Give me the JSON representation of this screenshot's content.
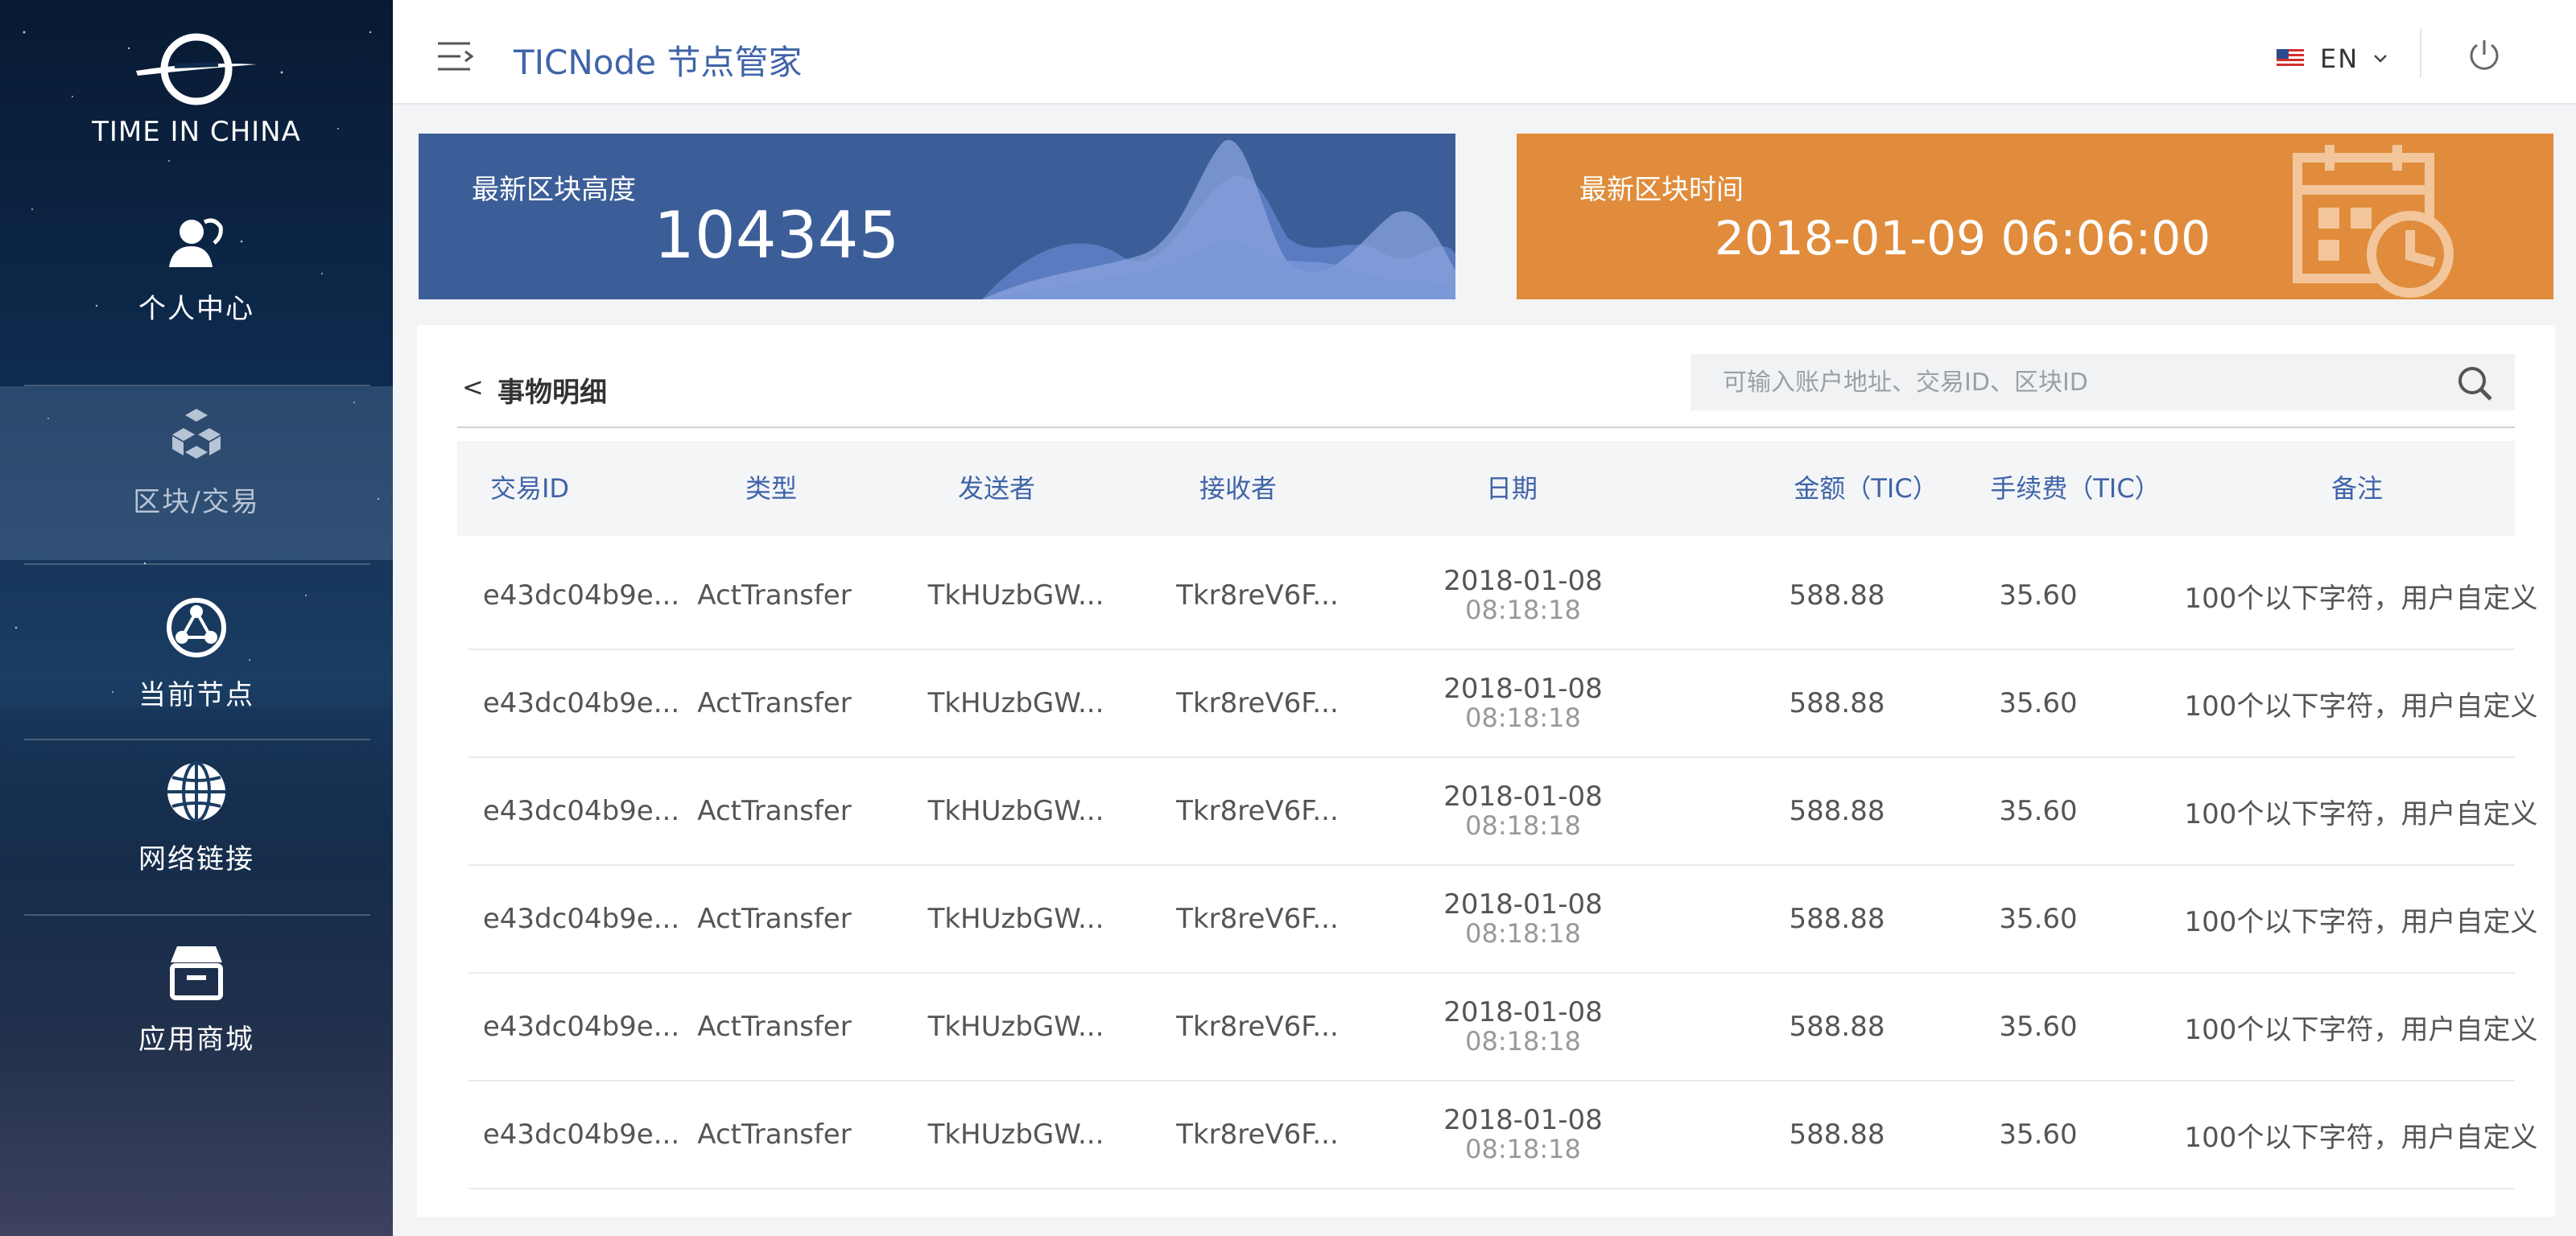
{
  "brand": {
    "logo_text": "TIME IN CHINA"
  },
  "sidebar": {
    "items": [
      {
        "label": "个人中心",
        "icon": "user-icon",
        "active": false
      },
      {
        "label": "区块/交易",
        "icon": "cubes-icon",
        "active": true
      },
      {
        "label": "当前节点",
        "icon": "node-icon",
        "active": false
      },
      {
        "label": "网络链接",
        "icon": "globe-icon",
        "active": false
      },
      {
        "label": "应用商城",
        "icon": "store-icon",
        "active": false
      }
    ]
  },
  "header": {
    "title": "TICNode 节点管家",
    "language": "EN"
  },
  "cards": {
    "block_height": {
      "label": "最新区块高度",
      "value": "104345"
    },
    "block_time": {
      "label": "最新区块时间",
      "value": "2018-01-09 06:06:00"
    }
  },
  "panel": {
    "back_label": "<",
    "title": "事物明细",
    "search_placeholder": "可输入账户地址、交易ID、区块ID"
  },
  "table": {
    "columns": [
      "交易ID",
      "类型",
      "发送者",
      "接收者",
      "日期",
      "金额（TIC）",
      "手续费（TIC）",
      "备注"
    ],
    "rows": [
      {
        "id": "e43dc04b9e...",
        "type": "ActTransfer",
        "sender": "TkHUzbGW...",
        "receiver": "Tkr8reV6F...",
        "date": "2018-01-08",
        "time": "08:18:18",
        "amount": "588.88",
        "fee": "35.60",
        "note": "100个以下字符，用户自定义"
      },
      {
        "id": "e43dc04b9e...",
        "type": "ActTransfer",
        "sender": "TkHUzbGW...",
        "receiver": "Tkr8reV6F...",
        "date": "2018-01-08",
        "time": "08:18:18",
        "amount": "588.88",
        "fee": "35.60",
        "note": "100个以下字符，用户自定义"
      },
      {
        "id": "e43dc04b9e...",
        "type": "ActTransfer",
        "sender": "TkHUzbGW...",
        "receiver": "Tkr8reV6F...",
        "date": "2018-01-08",
        "time": "08:18:18",
        "amount": "588.88",
        "fee": "35.60",
        "note": "100个以下字符，用户自定义"
      },
      {
        "id": "e43dc04b9e...",
        "type": "ActTransfer",
        "sender": "TkHUzbGW...",
        "receiver": "Tkr8reV6F...",
        "date": "2018-01-08",
        "time": "08:18:18",
        "amount": "588.88",
        "fee": "35.60",
        "note": "100个以下字符，用户自定义"
      },
      {
        "id": "e43dc04b9e...",
        "type": "ActTransfer",
        "sender": "TkHUzbGW...",
        "receiver": "Tkr8reV6F...",
        "date": "2018-01-08",
        "time": "08:18:18",
        "amount": "588.88",
        "fee": "35.60",
        "note": "100个以下字符，用户自定义"
      },
      {
        "id": "e43dc04b9e...",
        "type": "ActTransfer",
        "sender": "TkHUzbGW...",
        "receiver": "Tkr8reV6F...",
        "date": "2018-01-08",
        "time": "08:18:18",
        "amount": "588.88",
        "fee": "35.60",
        "note": "100个以下字符，用户自定义"
      }
    ]
  },
  "colors": {
    "accent_blue": "#3f64a8",
    "card_blue": "#3c5e98",
    "card_orange": "#e08c3c",
    "sidebar_dark": "#0e2a4d"
  }
}
